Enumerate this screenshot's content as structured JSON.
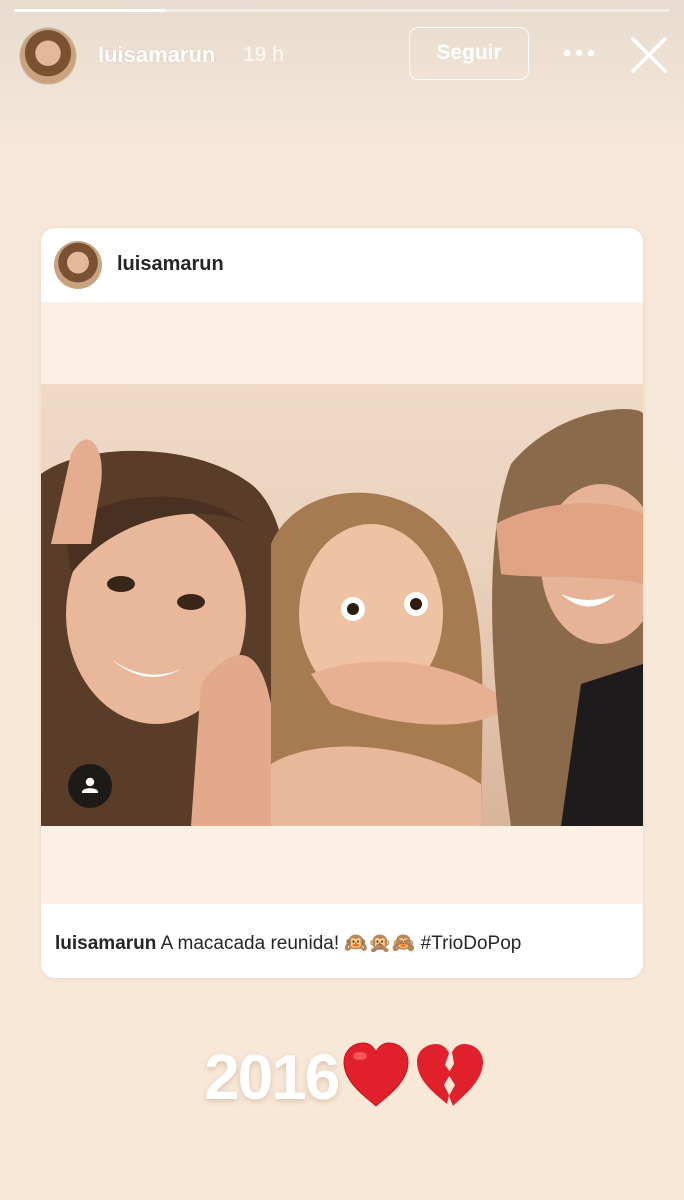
{
  "story": {
    "progress_fraction": 0.23,
    "username": "luisamarun",
    "time": "19 h",
    "follow_label": "Seguir",
    "more_icon": "more-icon",
    "close_icon": "close-icon"
  },
  "post": {
    "username": "luisamarun",
    "caption_user": "luisamarun",
    "caption_text": "A macacada reunida! 🙉🙊🙈 #TrioDoPop",
    "tag_icon": "user-tag-icon"
  },
  "sticker": {
    "year": "2016",
    "emojis": [
      "red-heart-icon",
      "broken-heart-icon"
    ]
  },
  "colors": {
    "background": "#f9e8d8",
    "heart_red": "#e0202a"
  }
}
